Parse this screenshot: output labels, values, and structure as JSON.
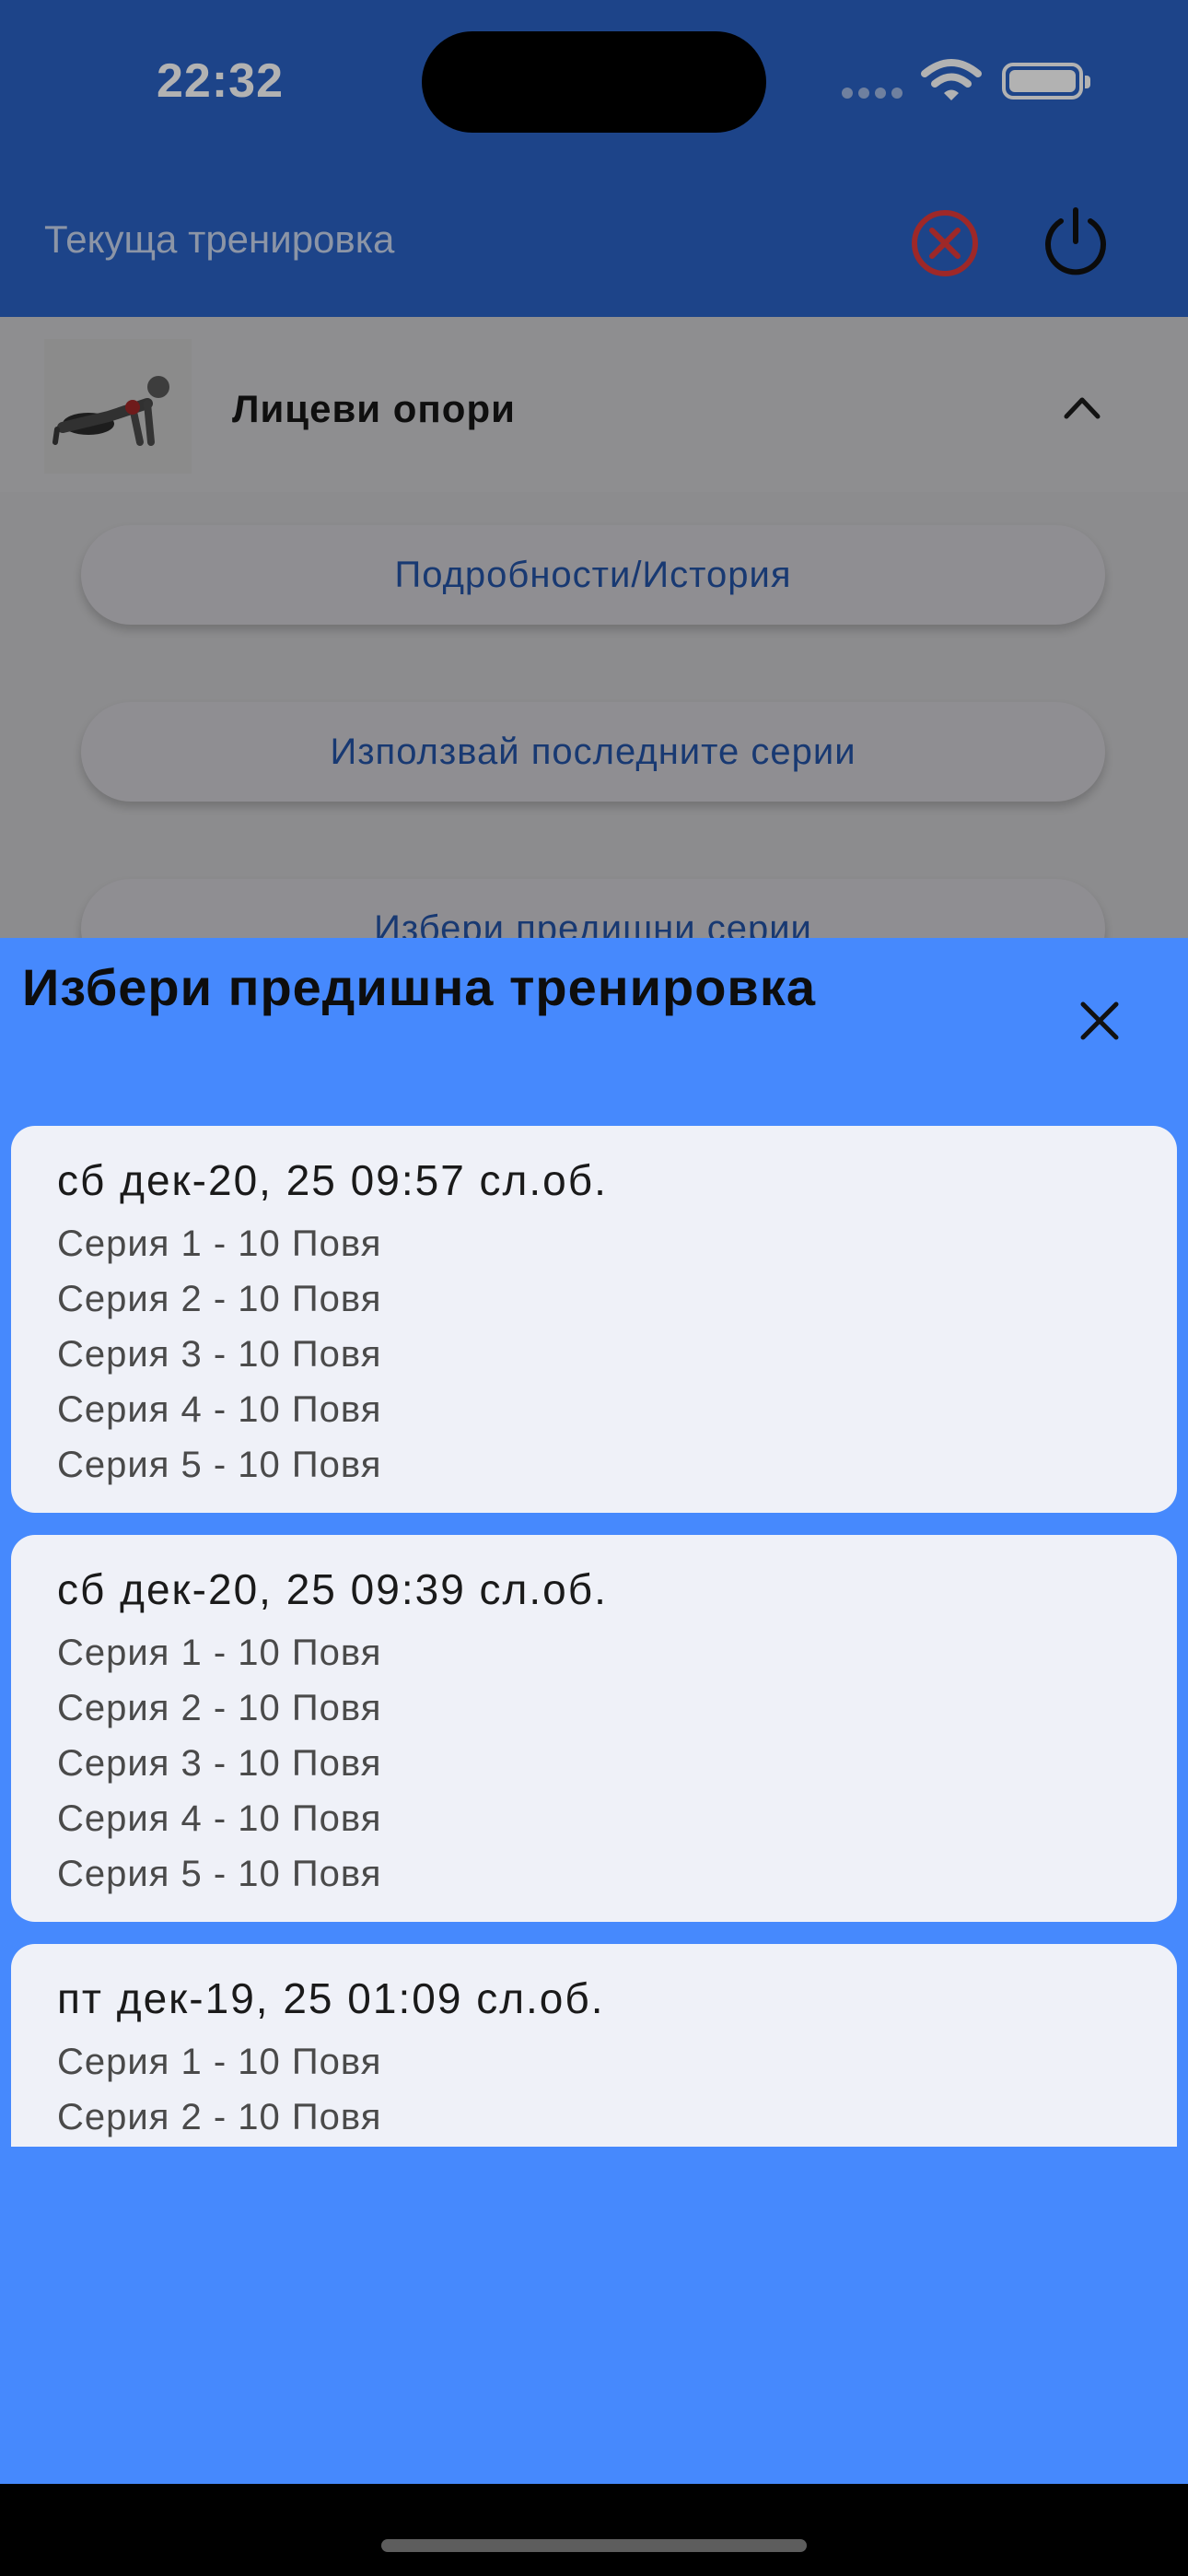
{
  "status_bar": {
    "time": "22:32"
  },
  "app_bar": {
    "title": "Текуща тренировка"
  },
  "exercise": {
    "name": "Лицеви опори"
  },
  "background_buttons": [
    {
      "label": "Подробности/История"
    },
    {
      "label": "Използвай последните серии"
    },
    {
      "label": "Избери предишни серии"
    }
  ],
  "sheet": {
    "title": "Избери предишна тренировка",
    "workouts": [
      {
        "date": "сб дек-20, 25 09:57 сл.об.",
        "sets": [
          "Серия 1 - 10 Повя",
          "Серия 2 - 10 Повя",
          "Серия 3 - 10 Повя",
          "Серия 4 - 10 Повя",
          "Серия 5 - 10 Повя"
        ]
      },
      {
        "date": "сб дек-20, 25 09:39 сл.об.",
        "sets": [
          "Серия 1 - 10 Повя",
          "Серия 2 - 10 Повя",
          "Серия 3 - 10 Повя",
          "Серия 4 - 10 Повя",
          "Серия 5 - 10 Повя"
        ]
      },
      {
        "date": "пт дек-19, 25 01:09 сл.об.",
        "sets": [
          "Серия 1 - 10 Повя",
          "Серия 2 - 10 Повя"
        ]
      }
    ]
  },
  "colors": {
    "app_bar": "#2a62c4",
    "sheet": "#4689fd",
    "card": "#eff1f8",
    "cancel": "#e23a3a"
  },
  "icons": {
    "cancel": "circle-x-icon",
    "power": "power-icon",
    "collapse": "chevron-up-icon",
    "close": "close-icon"
  }
}
